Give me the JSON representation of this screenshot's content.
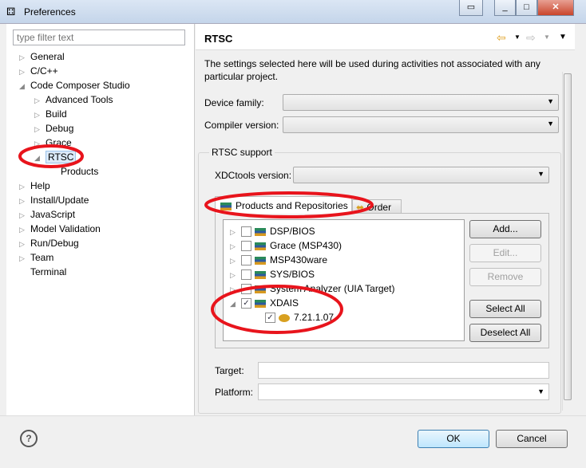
{
  "window": {
    "title": "Preferences"
  },
  "filter": {
    "placeholder": "type filter text"
  },
  "tree": [
    {
      "label": "General",
      "level": 0,
      "state": "collapsed"
    },
    {
      "label": "C/C++",
      "level": 0,
      "state": "collapsed"
    },
    {
      "label": "Code Composer Studio",
      "level": 0,
      "state": "expanded"
    },
    {
      "label": "Advanced Tools",
      "level": 1,
      "state": "collapsed"
    },
    {
      "label": "Build",
      "level": 1,
      "state": "collapsed"
    },
    {
      "label": "Debug",
      "level": 1,
      "state": "collapsed"
    },
    {
      "label": "Grace",
      "level": 1,
      "state": "collapsed"
    },
    {
      "label": "RTSC",
      "level": 1,
      "state": "expanded",
      "selected": true
    },
    {
      "label": "Products",
      "level": 2,
      "state": "leaf"
    },
    {
      "label": "Help",
      "level": 0,
      "state": "collapsed"
    },
    {
      "label": "Install/Update",
      "level": 0,
      "state": "collapsed"
    },
    {
      "label": "JavaScript",
      "level": 0,
      "state": "collapsed"
    },
    {
      "label": "Model Validation",
      "level": 0,
      "state": "collapsed"
    },
    {
      "label": "Run/Debug",
      "level": 0,
      "state": "collapsed"
    },
    {
      "label": "Team",
      "level": 0,
      "state": "collapsed"
    },
    {
      "label": "Terminal",
      "level": 0,
      "state": "leaf"
    }
  ],
  "page": {
    "title": "RTSC",
    "description": "The settings selected here will be used during activities not associated with any particular project.",
    "device_family_label": "Device family:",
    "device_family_value": "",
    "compiler_version_label": "Compiler version:",
    "compiler_version_value": "",
    "rtsc_support_label": "RTSC support",
    "xdctools_label": "XDCtools version:",
    "xdctools_value": "",
    "tabs": [
      "Products and Repositories",
      "Order"
    ],
    "products": [
      {
        "label": "DSP/BIOS",
        "checked": false,
        "state": "collapsed"
      },
      {
        "label": "Grace (MSP430)",
        "checked": false,
        "state": "collapsed"
      },
      {
        "label": "MSP430ware",
        "checked": false,
        "state": "collapsed"
      },
      {
        "label": "SYS/BIOS",
        "checked": false,
        "state": "collapsed"
      },
      {
        "label": "System Analyzer (UIA Target)",
        "checked": false,
        "state": "collapsed"
      },
      {
        "label": "XDAIS",
        "checked": true,
        "state": "expanded"
      },
      {
        "label": "7.21.1.07",
        "checked": true,
        "state": "child"
      }
    ],
    "buttons": {
      "add": "Add...",
      "edit": "Edit...",
      "remove": "Remove",
      "select_all": "Select All",
      "deselect_all": "Deselect All"
    },
    "target_label": "Target:",
    "target_value": "",
    "platform_label": "Platform:",
    "platform_value": ""
  },
  "footer": {
    "ok": "OK",
    "cancel": "Cancel"
  },
  "annotation_color": "#e8141c"
}
